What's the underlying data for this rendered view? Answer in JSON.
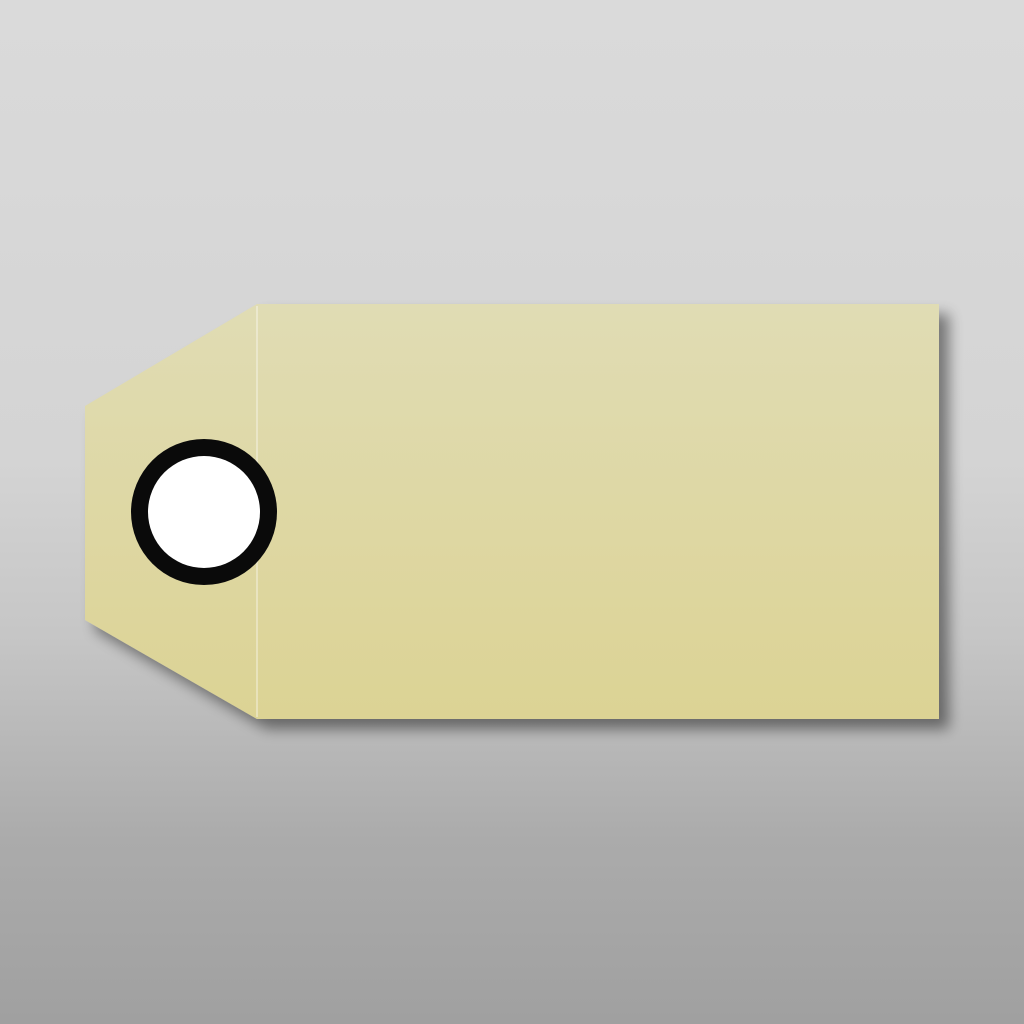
{
  "icon": {
    "name": "shipping-tag-icon",
    "colors": {
      "background_top": "#dadada",
      "background_bottom": "#a0a0a0",
      "tag_top": "#e0dcb4",
      "tag_bottom": "#dcd394",
      "eyelet_ring": "#0a0a0a",
      "eyelet_hole": "#ffffff"
    }
  }
}
